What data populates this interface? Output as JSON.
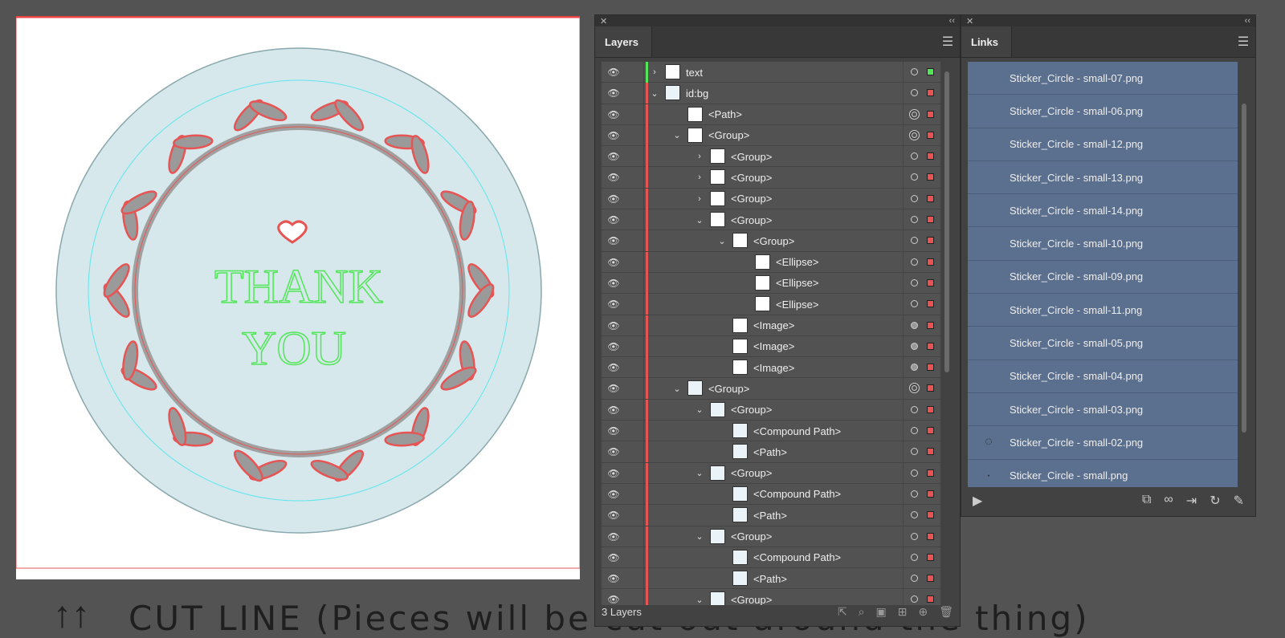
{
  "canvas": {
    "artwork_text_line1": "THANK",
    "artwork_text_line2": "YOU",
    "cutline_text": "CUT LINE (Pieces will be cut out around the thing)",
    "arrows": "↑↑"
  },
  "layers_panel": {
    "tab_label": "Layers",
    "footer_count": "3 Layers",
    "rows": [
      {
        "name": "text",
        "indent": 0,
        "twirl": "›",
        "bar": "green",
        "target": "plain",
        "sel": "green",
        "thumb": "white"
      },
      {
        "name": "id:bg",
        "indent": 0,
        "twirl": "⌄",
        "bar": "red",
        "target": "plain",
        "sel": "red",
        "thumb": "blue"
      },
      {
        "name": "<Path>",
        "indent": 1,
        "twirl": "",
        "bar": "red",
        "target": "double",
        "sel": "red",
        "thumb": "white"
      },
      {
        "name": "<Group>",
        "indent": 1,
        "twirl": "⌄",
        "bar": "red",
        "target": "double",
        "sel": "red",
        "thumb": "white"
      },
      {
        "name": "<Group>",
        "indent": 2,
        "twirl": "›",
        "bar": "red",
        "target": "plain",
        "sel": "red",
        "thumb": "white"
      },
      {
        "name": "<Group>",
        "indent": 2,
        "twirl": "›",
        "bar": "red",
        "target": "plain",
        "sel": "red",
        "thumb": "white"
      },
      {
        "name": "<Group>",
        "indent": 2,
        "twirl": "›",
        "bar": "red",
        "target": "plain",
        "sel": "red",
        "thumb": "white"
      },
      {
        "name": "<Group>",
        "indent": 2,
        "twirl": "⌄",
        "bar": "red",
        "target": "plain",
        "sel": "red",
        "thumb": "white"
      },
      {
        "name": "<Group>",
        "indent": 3,
        "twirl": "⌄",
        "bar": "red",
        "target": "plain",
        "sel": "red",
        "thumb": "white"
      },
      {
        "name": "<Ellipse>",
        "indent": 4,
        "twirl": "",
        "bar": "red",
        "target": "plain",
        "sel": "red",
        "thumb": "white"
      },
      {
        "name": "<Ellipse>",
        "indent": 4,
        "twirl": "",
        "bar": "red",
        "target": "plain",
        "sel": "red",
        "thumb": "white"
      },
      {
        "name": "<Ellipse>",
        "indent": 4,
        "twirl": "",
        "bar": "red",
        "target": "plain",
        "sel": "red",
        "thumb": "white"
      },
      {
        "name": "<Image>",
        "indent": 3,
        "twirl": "",
        "bar": "red",
        "target": "filled",
        "sel": "red",
        "thumb": "white"
      },
      {
        "name": "<Image>",
        "indent": 3,
        "twirl": "",
        "bar": "red",
        "target": "filled",
        "sel": "red",
        "thumb": "white"
      },
      {
        "name": "<Image>",
        "indent": 3,
        "twirl": "",
        "bar": "red",
        "target": "filled",
        "sel": "red",
        "thumb": "white"
      },
      {
        "name": "<Group>",
        "indent": 1,
        "twirl": "⌄",
        "bar": "red",
        "target": "double",
        "sel": "red",
        "thumb": "blue"
      },
      {
        "name": "<Group>",
        "indent": 2,
        "twirl": "⌄",
        "bar": "red",
        "target": "plain",
        "sel": "red",
        "thumb": "blue"
      },
      {
        "name": "<Compound Path>",
        "indent": 3,
        "twirl": "",
        "bar": "red",
        "target": "plain",
        "sel": "red",
        "thumb": "blue"
      },
      {
        "name": "<Path>",
        "indent": 3,
        "twirl": "",
        "bar": "red",
        "target": "plain",
        "sel": "red",
        "thumb": "blue"
      },
      {
        "name": "<Group>",
        "indent": 2,
        "twirl": "⌄",
        "bar": "red",
        "target": "plain",
        "sel": "red",
        "thumb": "blue"
      },
      {
        "name": "<Compound Path>",
        "indent": 3,
        "twirl": "",
        "bar": "red",
        "target": "plain",
        "sel": "red",
        "thumb": "blue"
      },
      {
        "name": "<Path>",
        "indent": 3,
        "twirl": "",
        "bar": "red",
        "target": "plain",
        "sel": "red",
        "thumb": "blue"
      },
      {
        "name": "<Group>",
        "indent": 2,
        "twirl": "⌄",
        "bar": "red",
        "target": "plain",
        "sel": "red",
        "thumb": "blue"
      },
      {
        "name": "<Compound Path>",
        "indent": 3,
        "twirl": "",
        "bar": "red",
        "target": "plain",
        "sel": "red",
        "thumb": "blue"
      },
      {
        "name": "<Path>",
        "indent": 3,
        "twirl": "",
        "bar": "red",
        "target": "plain",
        "sel": "red",
        "thumb": "blue"
      },
      {
        "name": "<Group>",
        "indent": 2,
        "twirl": "⌄",
        "bar": "red",
        "target": "plain",
        "sel": "red",
        "thumb": "blue"
      }
    ]
  },
  "links_panel": {
    "tab_label": "Links",
    "items": [
      "Sticker_Circle - small-07.png",
      "Sticker_Circle - small-06.png",
      "Sticker_Circle - small-12.png",
      "Sticker_Circle - small-13.png",
      "Sticker_Circle - small-14.png",
      "Sticker_Circle - small-10.png",
      "Sticker_Circle - small-09.png",
      "Sticker_Circle - small-11.png",
      "Sticker_Circle - small-05.png",
      "Sticker_Circle - small-04.png",
      "Sticker_Circle - small-03.png",
      "Sticker_Circle - small-02.png",
      "Sticker_Circle - small.png"
    ]
  },
  "colors": {
    "selection_red": "#e65454",
    "selection_green": "#54e65a",
    "link_highlight": "#5b6f8e",
    "sticker_fill": "#d6e8ec"
  }
}
